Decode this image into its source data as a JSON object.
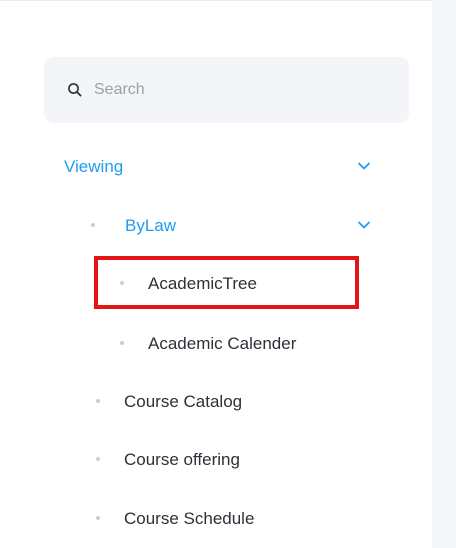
{
  "search": {
    "placeholder": "Search",
    "icon": "search-icon"
  },
  "menu": {
    "viewing": {
      "label": "Viewing",
      "expanded": true,
      "color": "#1e9df2"
    },
    "bylaw": {
      "label": "ByLaw",
      "expanded": true,
      "color": "#1e9df2"
    },
    "academic_tree": {
      "label": "AcademicTree",
      "highlighted": true,
      "highlight_color": "#e51414"
    },
    "academic_calender": {
      "label": "Academic Calender"
    },
    "course_catalog": {
      "label": "Course Catalog"
    },
    "course_offering": {
      "label": "Course offering"
    },
    "course_schedule": {
      "label": "Course Schedule"
    }
  },
  "colors": {
    "text": "#2c3138",
    "muted": "#9aa1ab",
    "dot": "#c9ced6",
    "search_bg": "#f3f5f8"
  }
}
